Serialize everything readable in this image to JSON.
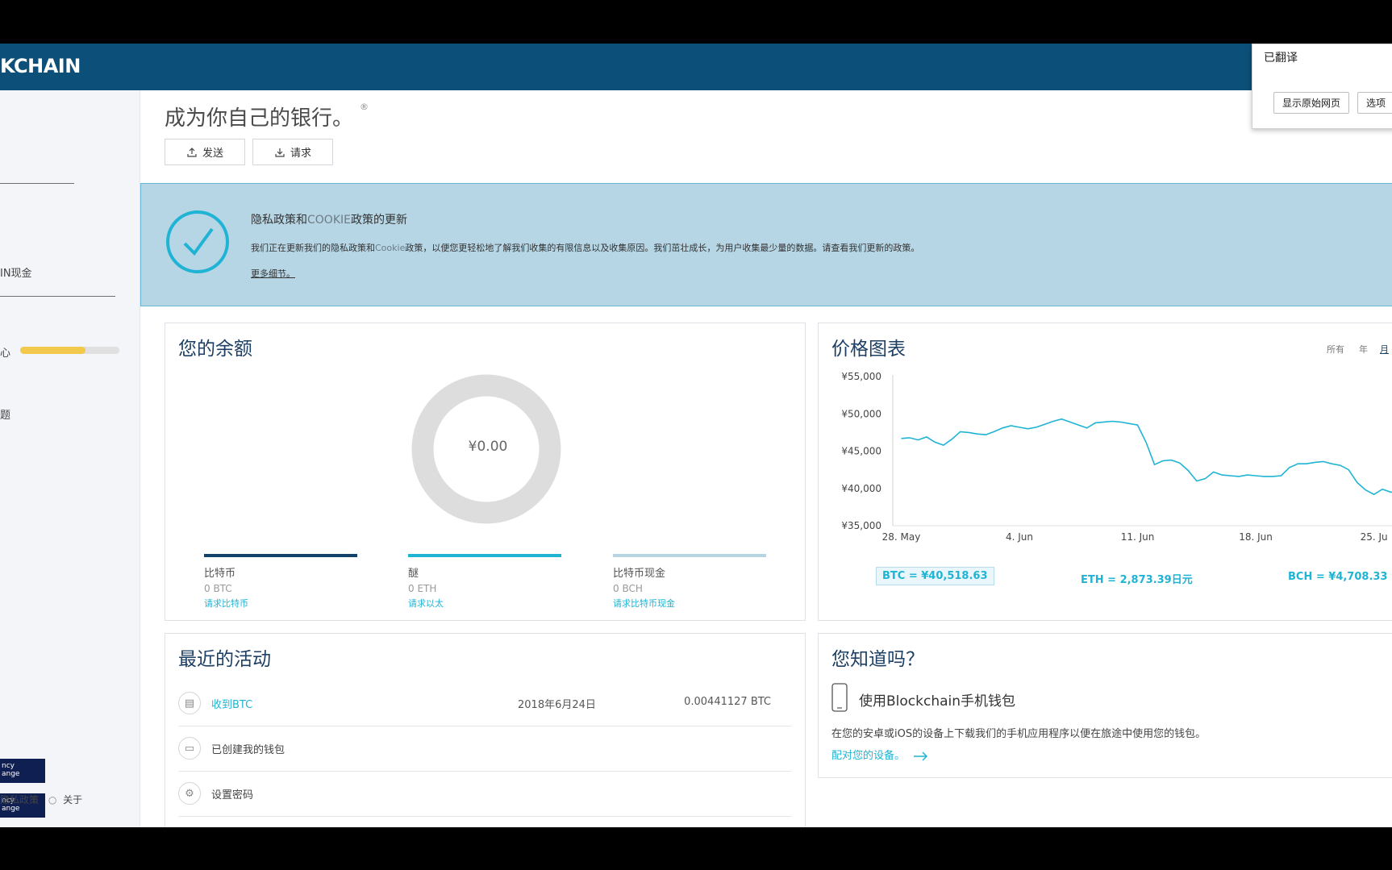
{
  "header": {
    "logo": "KCHAIN"
  },
  "translate_popup": {
    "title": "已翻译",
    "show_original": "显示原始网页",
    "options": "选项"
  },
  "sidebar": {
    "item_cash": "IN现金",
    "item_security": "心",
    "security_progress": 0.66,
    "item_faq": "题",
    "badge_1": "ncy\nange",
    "badge_2": "ncy\nange",
    "footer_privacy": "隐私政策",
    "footer_about": "关于"
  },
  "main": {
    "title": "成为你自己的银行。",
    "send": "发送",
    "request": "请求"
  },
  "banner": {
    "title_a": "隐私政策和",
    "title_cookie": "COOKIE",
    "title_b": "政策的更新",
    "body_a": "我们正在更新我们的隐私政策和",
    "body_cookie": "Cookie",
    "body_b": "政策，以便您更轻松地了解我们收集的有限信息以及收集原因。我们茁壮成长，为用户收集最少量的数据。请查看我们更新的政策。",
    "link": "更多细节。"
  },
  "balance": {
    "title": "您的余额",
    "total": "¥0.00",
    "coins": [
      {
        "name": "比特币",
        "amount": "0 BTC",
        "request": "请求比特币",
        "color": "#10426b"
      },
      {
        "name": "醚",
        "amount": "0 ETH",
        "request": "请求以太",
        "color": "#1fb4d4"
      },
      {
        "name": "比特币现金",
        "amount": "0 BCH",
        "request": "请求比特币现金",
        "color": "#b6d5e0"
      }
    ]
  },
  "chart": {
    "title": "价格图表",
    "timeframes": [
      "所有",
      "年",
      "月"
    ],
    "active_timeframe": "月",
    "prices": {
      "btc": "BTC =  ¥40,518.63",
      "eth": "ETH =  2,873.39日元",
      "bch": "BCH =  ¥4,708.33"
    }
  },
  "chart_data": {
    "type": "line",
    "ylim": [
      35000,
      55000
    ],
    "yticks": [
      "¥55,000",
      "¥50,000",
      "¥45,000",
      "¥40,000",
      "¥35,000"
    ],
    "ytick_values": [
      55000,
      50000,
      45000,
      40000,
      35000
    ],
    "xticks": [
      "28. May",
      "4. Jun",
      "11. Jun",
      "18. Jun",
      "25. Ju"
    ],
    "xtick_days": [
      0,
      7,
      14,
      21,
      28
    ],
    "xlim": [
      -0.5,
      29.5
    ],
    "color": "#1fb4d4",
    "series": [
      {
        "x": [
          0,
          0.5,
          1,
          1.5,
          2,
          2.5,
          3,
          3.5,
          4,
          4.5,
          5,
          5.5,
          6,
          6.5,
          7,
          7.5,
          8,
          8.5,
          9,
          9.5,
          10,
          10.5,
          11,
          11.5,
          12,
          12.5,
          13,
          13.5,
          14,
          14.5,
          15,
          15.5,
          16,
          16.5,
          17,
          17.5,
          18,
          18.5,
          19,
          19.5,
          20,
          20.5,
          21,
          21.5,
          22,
          22.5,
          23,
          23.5,
          24,
          24.5,
          25,
          25.5,
          26,
          26.5,
          27,
          27.5,
          28,
          28.5,
          29,
          29.5
        ],
        "values": [
          46700,
          46800,
          46500,
          46900,
          46200,
          45800,
          46600,
          47600,
          47500,
          47300,
          47200,
          47600,
          48100,
          48400,
          48200,
          48000,
          48200,
          48600,
          49000,
          49300,
          48900,
          48500,
          48100,
          48800,
          48900,
          49000,
          48900,
          48700,
          48500,
          46200,
          43200,
          43700,
          43800,
          43400,
          42400,
          41000,
          41300,
          42200,
          41800,
          41700,
          41600,
          41800,
          41700,
          41600,
          41600,
          41700,
          42800,
          43300,
          43300,
          43500,
          43600,
          43300,
          43100,
          42500,
          40800,
          39800,
          39200,
          39900,
          39500,
          39700
        ]
      }
    ]
  },
  "activity": {
    "title": "最近的活动",
    "rows": [
      {
        "label": "收到BTC",
        "date": "2018年6月24日",
        "amount": "0.00441127 BTC",
        "icon": "▤"
      },
      {
        "label": "已创建我的钱包",
        "date": "",
        "amount": "",
        "icon": "▭"
      },
      {
        "label": "设置密码",
        "date": "",
        "amount": "",
        "icon": "⚙"
      }
    ]
  },
  "didyouknow": {
    "title": "您知道吗？",
    "subtitle": "使用Blockchain手机钱包",
    "body": "在您的安卓或iOS的设备上下载我们的手机应用程序以便在旅途中使用您的钱包。",
    "link": "配对您的设备。"
  }
}
